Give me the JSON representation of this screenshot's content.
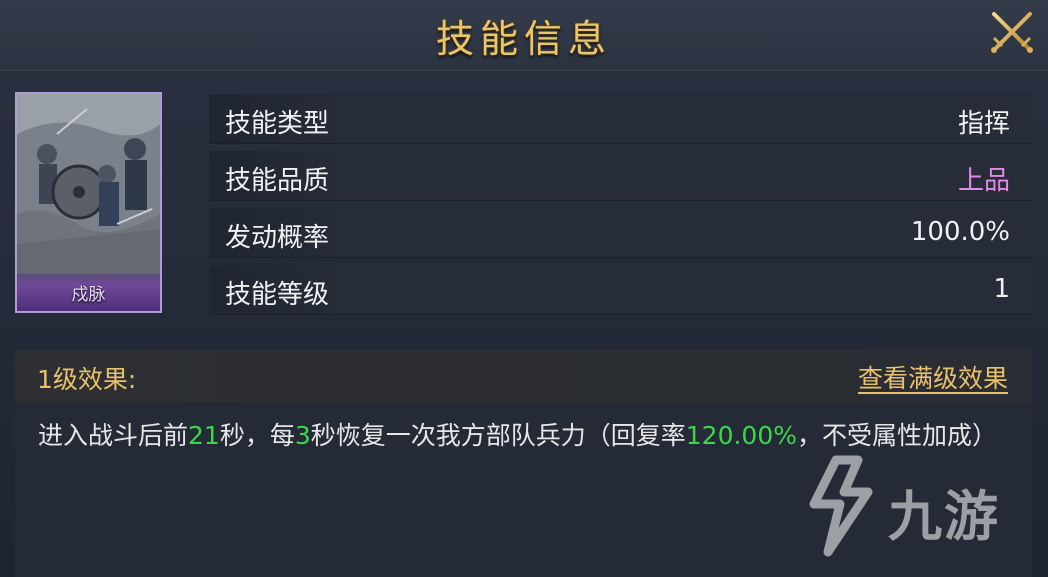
{
  "header": {
    "title": "技能信息"
  },
  "card": {
    "name": "戍脉"
  },
  "info_rows": [
    {
      "key": "技能类型",
      "value": "指挥",
      "value_color": "#f1f1f1"
    },
    {
      "key": "技能品质",
      "value": "上品",
      "value_color": "#e08ae8"
    },
    {
      "key": "发动概率",
      "value": "100.0%",
      "value_color": "#f1f1f1"
    },
    {
      "key": "技能等级",
      "value": "1",
      "value_color": "#f1f1f1"
    }
  ],
  "effect": {
    "level_label": "1级效果:",
    "max_link": "查看满级效果",
    "desc_parts": [
      "进入战斗后前",
      "21",
      "秒，每",
      "3",
      "秒恢复一次我方部队兵力（回复率",
      "120.00%",
      "，不受属性加成）"
    ],
    "highlight_color": "#3cd64a"
  },
  "watermark": {
    "text": "九游",
    "icon": "jiuyou-logo-icon"
  },
  "colors": {
    "gold": "#e9c56e",
    "panel": "#262c38",
    "purple_border": "#b49ad6"
  }
}
